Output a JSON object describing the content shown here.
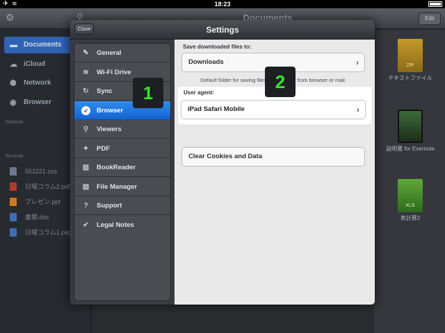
{
  "status_bar": {
    "time": "18:23"
  },
  "background_app": {
    "title": "Documents",
    "edit_label": "Edit",
    "sidebar": {
      "items": [
        {
          "label": "Documents",
          "icon": "folder-icon"
        },
        {
          "label": "iCloud",
          "icon": "cloud-icon"
        },
        {
          "label": "Network",
          "icon": "network-icon"
        },
        {
          "label": "Browser",
          "icon": "compass-icon"
        }
      ],
      "network_section": "Network",
      "recents_section": "Recents",
      "recents": [
        {
          "name": "552221.css",
          "color": "#6b7a8c"
        },
        {
          "name": "日曜コラム2.pdf",
          "color": "#b23a2a"
        },
        {
          "name": "プレゼン.ppt",
          "color": "#d07a1e"
        },
        {
          "name": "書類.doc",
          "color": "#3b6fb5"
        },
        {
          "name": "日曜コラム1.pag",
          "color": "#3b6fb5"
        }
      ]
    },
    "files": [
      {
        "name": "テキストファイル",
        "tag": "ZIP"
      },
      {
        "name": "説明書 for Evernote",
        "tag": ""
      },
      {
        "name": "表計算2",
        "tag": "XLS"
      }
    ]
  },
  "settings": {
    "title": "Settings",
    "close_label": "Close",
    "menu": [
      {
        "label": "General",
        "icon": "wrench-icon",
        "glyph": "✎"
      },
      {
        "label": "Wi-Fi Drive",
        "icon": "wifi-icon",
        "glyph": "≋"
      },
      {
        "label": "Sync",
        "icon": "sync-icon",
        "glyph": "↻"
      },
      {
        "label": "Browser",
        "icon": "compass-icon",
        "glyph": "➶",
        "selected": true
      },
      {
        "label": "Viewers",
        "icon": "magnifier-icon",
        "glyph": "⚲"
      },
      {
        "label": "PDF",
        "icon": "pdf-icon",
        "glyph": "✦"
      },
      {
        "label": "BookReader",
        "icon": "book-icon",
        "glyph": "▥"
      },
      {
        "label": "File Manager",
        "icon": "file-icon",
        "glyph": "▤"
      },
      {
        "label": "Support",
        "icon": "help-icon",
        "glyph": "?"
      },
      {
        "label": "Legal Notes",
        "icon": "check-icon",
        "glyph": "✔"
      }
    ],
    "browser": {
      "save_label": "Save downloaded files to:",
      "downloads_value": "Downloads",
      "folder_note": "Default folder for saving files downloaded from browser or mail.",
      "user_agent_label": "User agent:",
      "user_agent_value": "iPad Safari Mobile",
      "clear_label": "Clear Cookies and Data"
    }
  },
  "annotations": {
    "badge1": "1",
    "badge2": "2"
  },
  "colors": {
    "accent": "#1c6fe0",
    "badge_text": "#39e62a"
  }
}
